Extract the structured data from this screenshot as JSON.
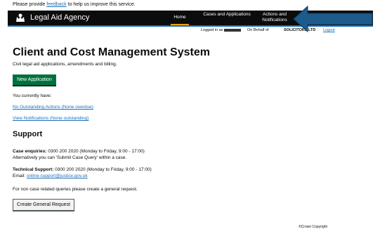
{
  "feedback": {
    "prefix": "Please provide ",
    "link": "feedback",
    "suffix": " to help us improve this service."
  },
  "header": {
    "agency": "Legal Aid Agency",
    "nav": [
      {
        "label": "Home"
      },
      {
        "label": "Cases and Applications"
      },
      {
        "label": "Actions and Notifications"
      }
    ],
    "logged_in_as": "Logged in as",
    "on_behalf_of": "On Behalf of",
    "firm": "SOLICITORS LTD",
    "logout": "Logout"
  },
  "main": {
    "title": "Client and Cost Management System",
    "subtitle": "Civil legal aid applications, amendments and billing.",
    "new_application": "New Application",
    "you_have": "You currently have:",
    "outstanding_link": "No Outstanding Actions (None overdue)",
    "notifications_link": "View Notifications (None outstanding)"
  },
  "support": {
    "heading": "Support",
    "case_label": "Case enquiries:",
    "case_text": " 0300 200 2020 (Monday to Friday, 9:00 - 17:00)",
    "case_alt": "Alternatively you can 'Submit Case Query' within a case.",
    "tech_label": "Technical Support:",
    "tech_text": " 0300 200 2020 (Monday to Friday, 9:00 - 17:00)",
    "email_label": "Email: ",
    "email": "online-support@justice.gov.uk",
    "non_case": "For non case related queries please create a general request.",
    "general_request": "Create General Request"
  },
  "footer": {
    "copyright": "©Crown Copyright"
  },
  "colors": {
    "header_bg": "#0b0c0c",
    "link": "#1d70b8",
    "primary_button": "#00703c",
    "arrow": "#1d5b8c"
  }
}
